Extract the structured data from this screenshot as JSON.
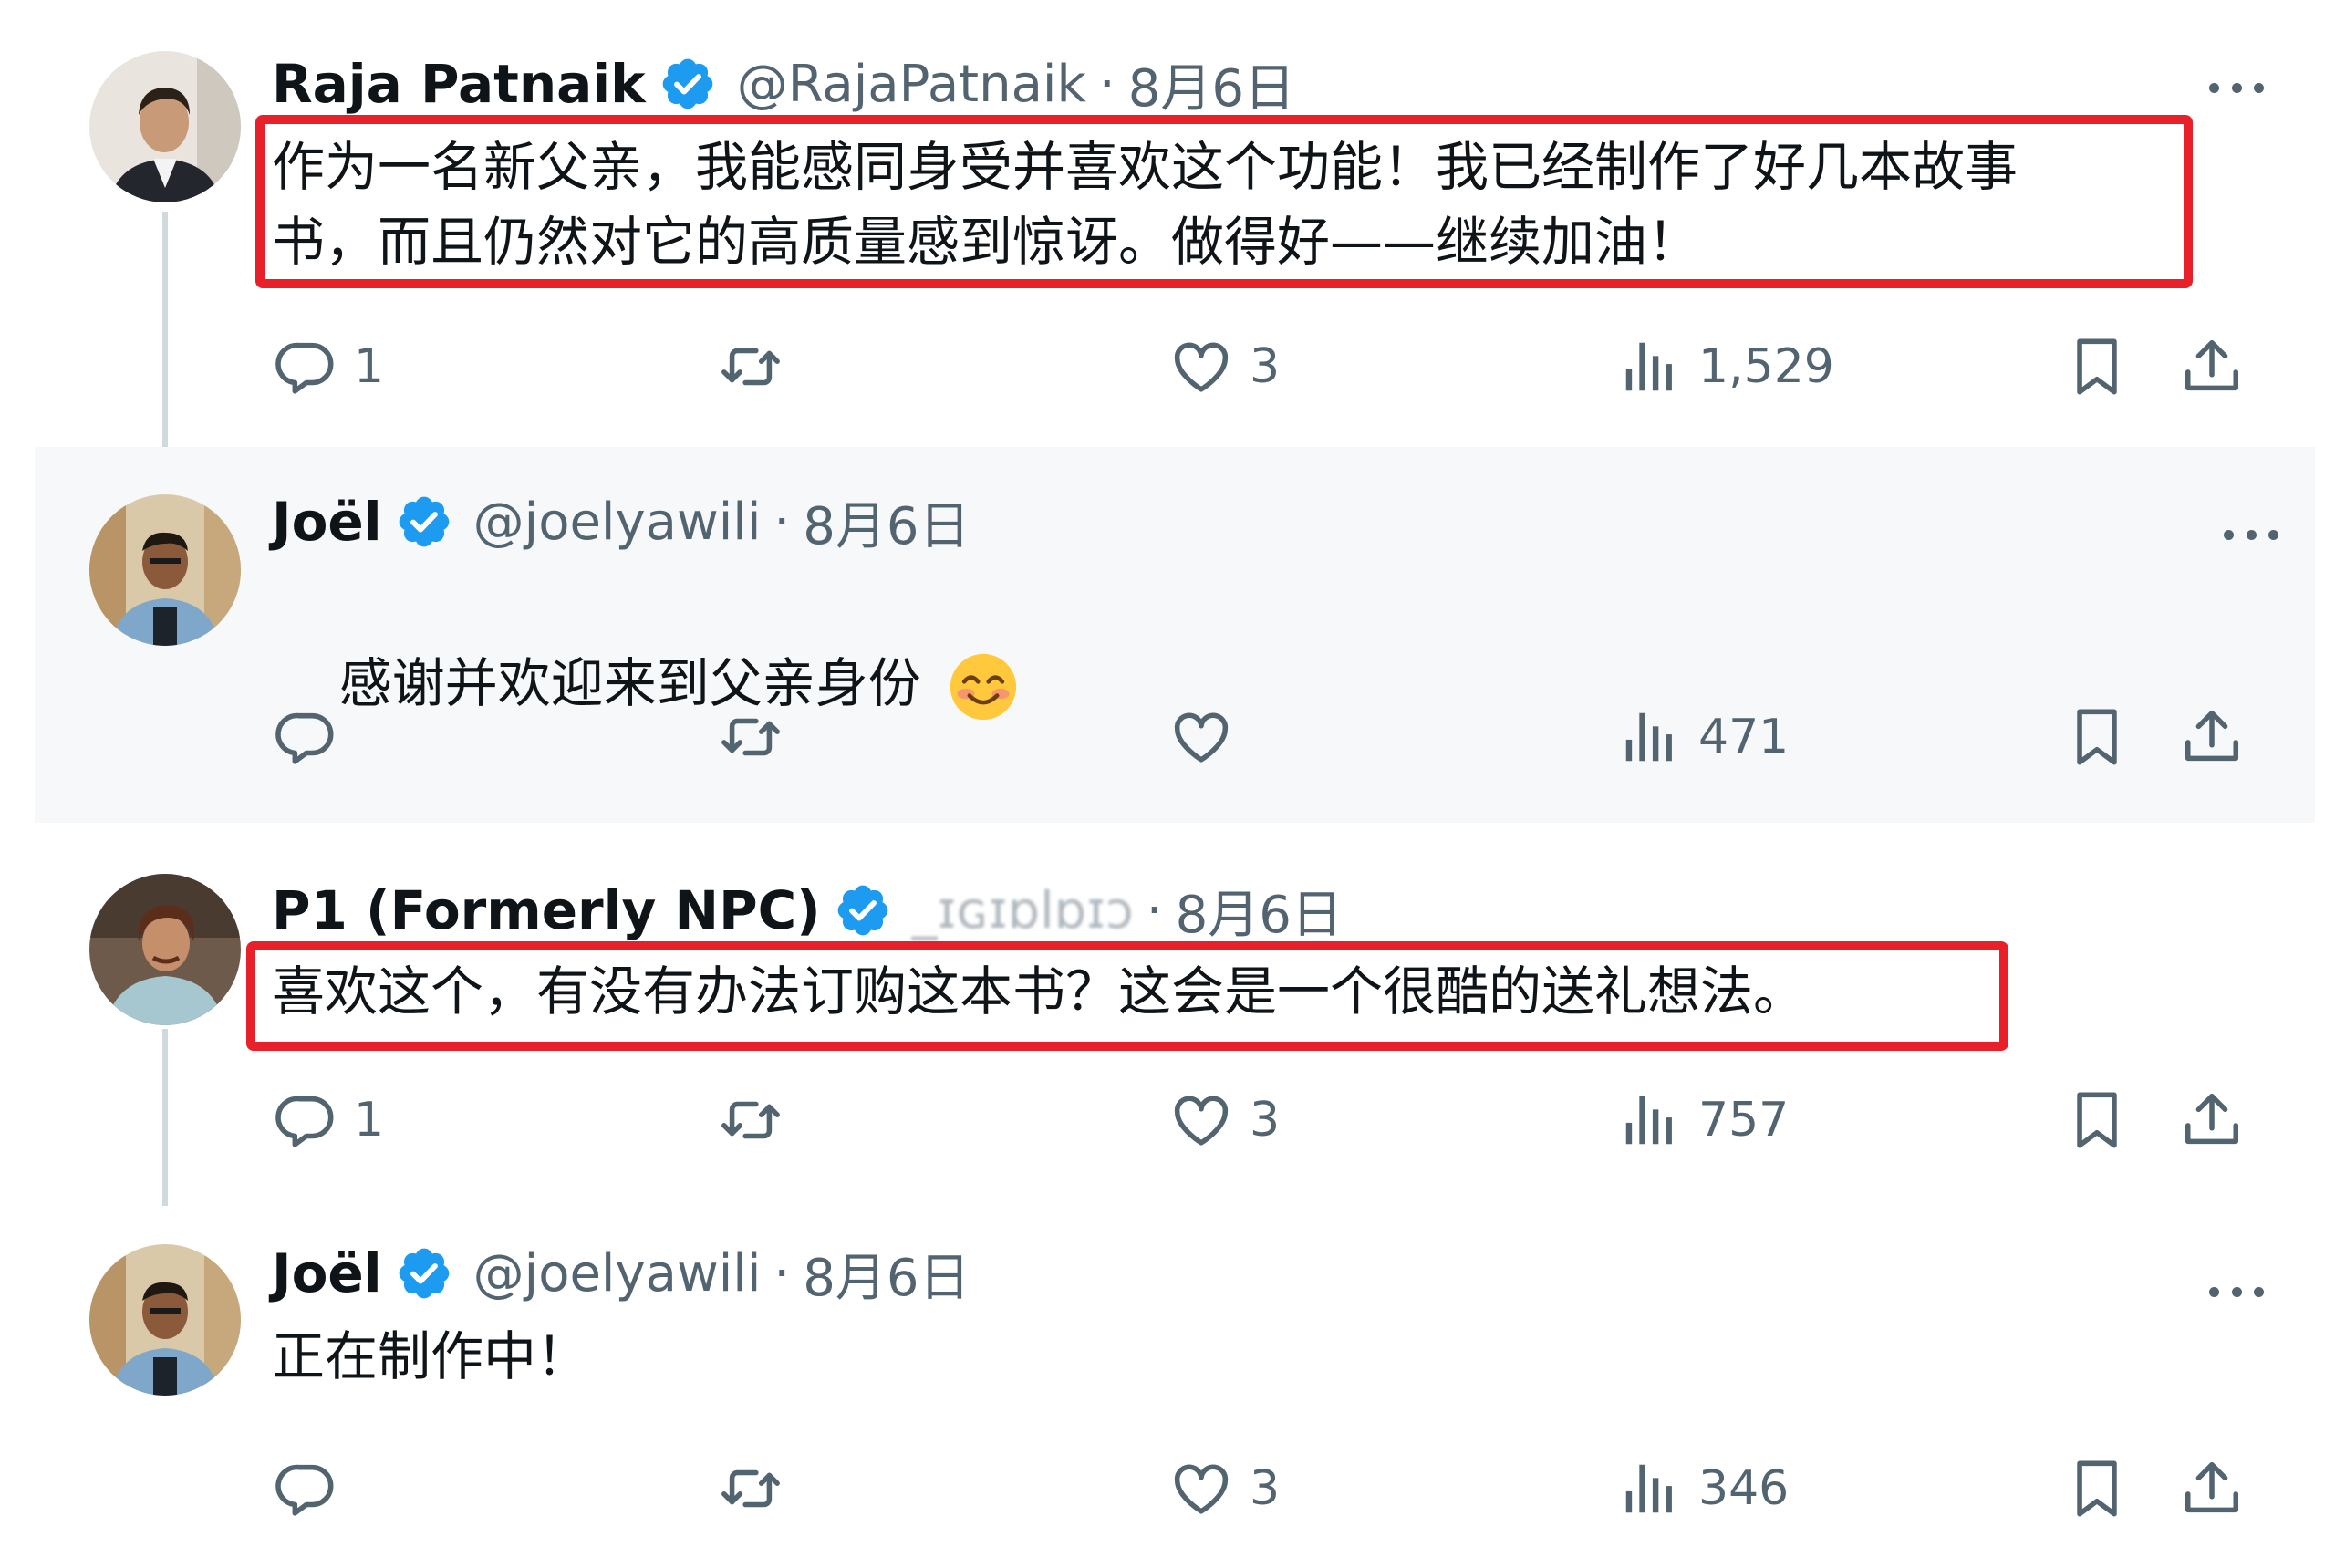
{
  "colors": {
    "verified": "#1d9bf0",
    "highlight": "#e8202a",
    "muted": "#536471"
  },
  "tweets": [
    {
      "name": "Raja Patnaik",
      "handle": "@RajaPatnaik",
      "dot": "·",
      "date": "8月6日",
      "text": "作为一名新父亲，我能感同身受并喜欢这个功能！我已经制作了好几本故事\n书，而且仍然对它的高质量感到惊讶。做得好——继续加油！",
      "replies": "1",
      "retweets": "",
      "likes": "3",
      "views": "1,529"
    },
    {
      "name": "Joël",
      "handle": "@joelyawili",
      "dot": "·",
      "date": "8月6日",
      "text": "感谢并欢迎来到父亲身份",
      "emoji": "smiling-face-emoji",
      "replies": "",
      "retweets": "",
      "likes": "",
      "views": "471"
    },
    {
      "name": "P1 (Formerly NPC)",
      "handle": "_ɪɢɪɒlɒɪɔ",
      "dot": "·",
      "date": "8月6日",
      "text": "喜欢这个，有没有办法订购这本书？这会是一个很酷的送礼想法。",
      "replies": "1",
      "retweets": "",
      "likes": "3",
      "views": "757"
    },
    {
      "name": "Joël",
      "handle": "@joelyawili",
      "dot": "·",
      "date": "8月6日",
      "text": "正在制作中！",
      "replies": "",
      "retweets": "",
      "likes": "3",
      "views": "346"
    }
  ]
}
